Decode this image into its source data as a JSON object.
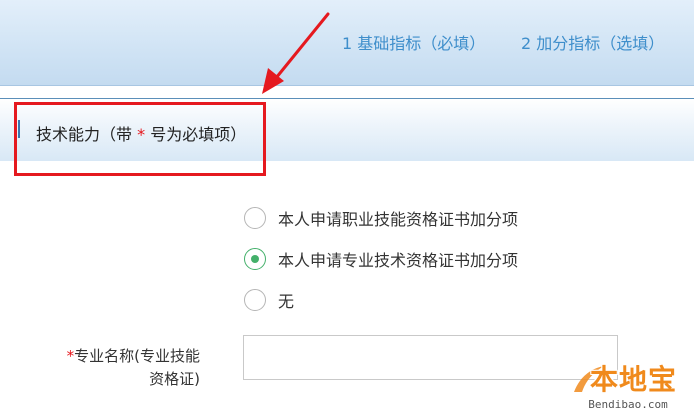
{
  "tabs": [
    {
      "label": "1 基础指标（必填）"
    },
    {
      "label": "2 加分指标（选填）"
    }
  ],
  "section": {
    "title_prefix": "技术能力（带",
    "star": "*",
    "title_suffix": "号为必填项）"
  },
  "options": [
    {
      "label": "本人申请职业技能资格证书加分项",
      "checked": false
    },
    {
      "label": "本人申请专业技术资格证书加分项",
      "checked": true
    },
    {
      "label": "无",
      "checked": false
    }
  ],
  "field": {
    "star": "*",
    "label_line1": "专业名称(专业技能",
    "label_line2": "资格证)",
    "value": ""
  },
  "watermark": {
    "text": "本地宝",
    "url": "Bendibao.com"
  },
  "colors": {
    "accent": "#3e8ecb",
    "required": "#e5141a",
    "checked": "#43b06a",
    "annotation": "#e5191f",
    "watermark": "#f08a1c"
  }
}
